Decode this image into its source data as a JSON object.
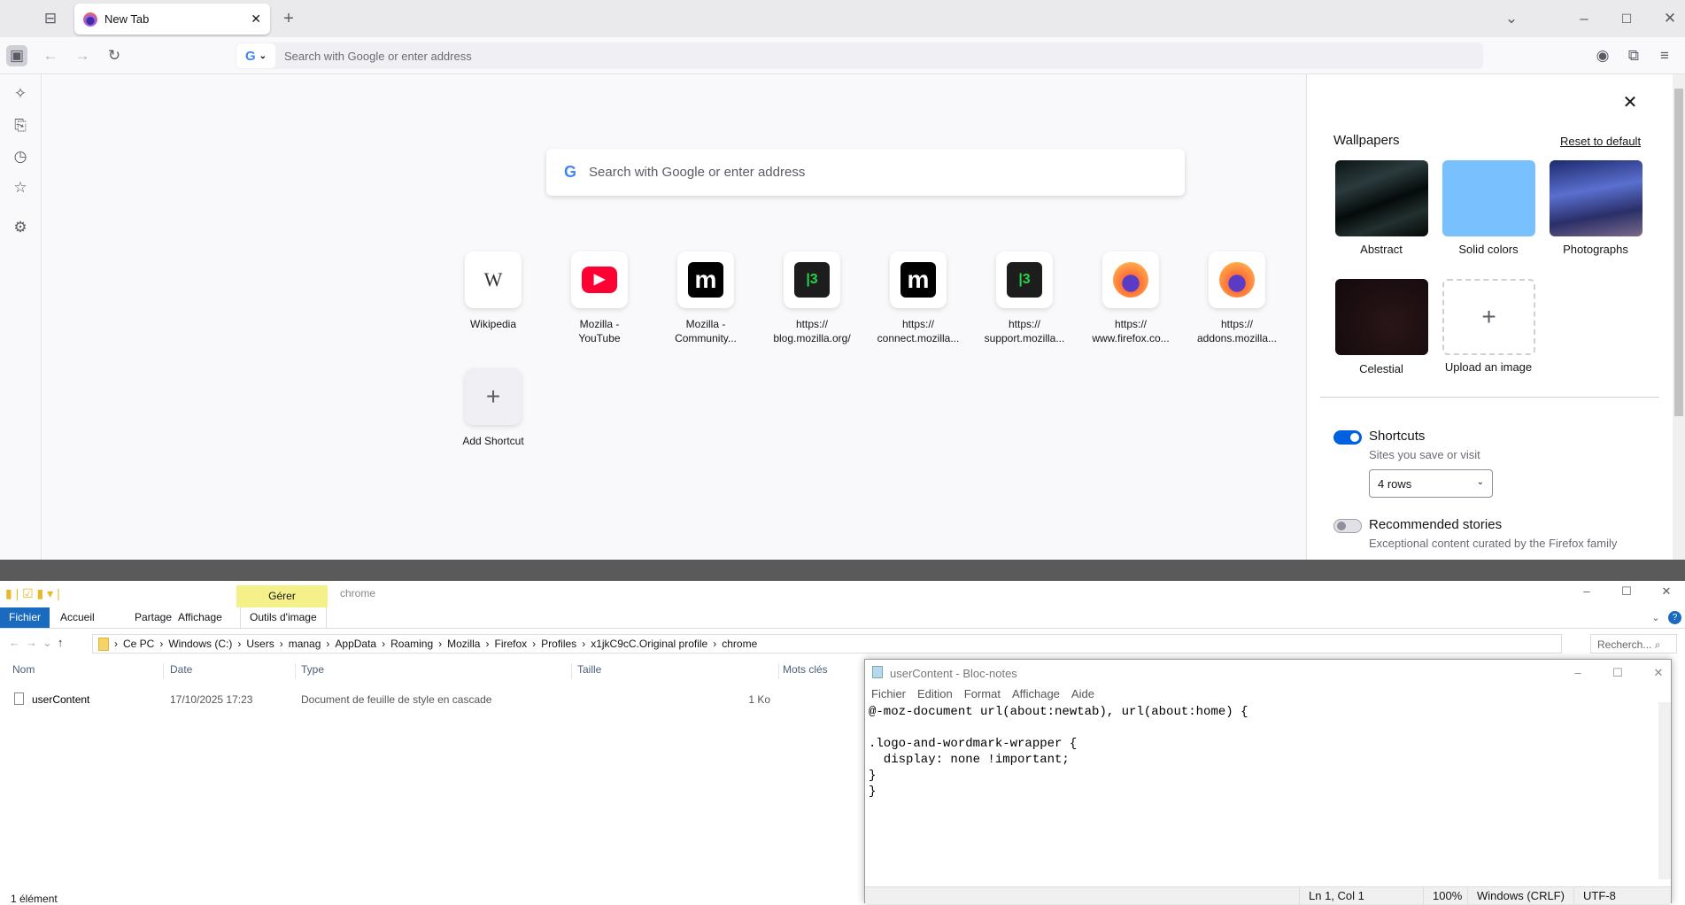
{
  "browser": {
    "tab_title": "New Tab",
    "url_placeholder": "Search with Google or enter address"
  },
  "newtab": {
    "search_placeholder": "Search with Google or enter address",
    "shortcuts": [
      {
        "line1": "Wikipedia",
        "line2": "",
        "icon": "W",
        "bg": "#ffffff",
        "fg": "#333333"
      },
      {
        "line1": "Mozilla -",
        "line2": "YouTube",
        "icon": "▶",
        "bg": "#ff0033",
        "fg": "#ffffff"
      },
      {
        "line1": "Mozilla -",
        "line2": "Community...",
        "icon": "m",
        "bg": "#000000",
        "fg": "#ffffff"
      },
      {
        "line1": "https://",
        "line2": "blog.mozilla.org/",
        "icon": "|3",
        "bg": "#1d1d1d",
        "fg": "#22d34b"
      },
      {
        "line1": "https://",
        "line2": "connect.mozilla...",
        "icon": "m",
        "bg": "#000000",
        "fg": "#ffffff"
      },
      {
        "line1": "https://",
        "line2": "support.mozilla...",
        "icon": "|3",
        "bg": "#1d1d1d",
        "fg": "#22d34b"
      },
      {
        "line1": "https://",
        "line2": "www.firefox.co...",
        "icon": "ff",
        "bg": "#ffffff",
        "fg": "#ff7139"
      },
      {
        "line1": "https://",
        "line2": "addons.mozilla...",
        "icon": "ff",
        "bg": "#ffffff",
        "fg": "#ff7139"
      }
    ],
    "add_shortcut": "Add Shortcut"
  },
  "panel": {
    "wallpapers_title": "Wallpapers",
    "reset": "Reset to default",
    "wallpapers": [
      "Abstract",
      "Solid colors",
      "Photographs",
      "Celestial",
      "Upload an image"
    ],
    "shortcuts_label": "Shortcuts",
    "shortcuts_desc": "Sites you save or visit",
    "shortcuts_on": true,
    "rows": "4 rows",
    "stories_label": "Recommended stories",
    "stories_desc": "Exceptional content curated by the Firefox family",
    "stories_on": false
  },
  "explorer": {
    "manage": "Gérer",
    "folder_title": "chrome",
    "ribbon_tabs": [
      "Fichier",
      "Accueil",
      "Partage",
      "Affichage",
      "Outils d'image"
    ],
    "path": [
      "Ce PC",
      "Windows (C:)",
      "Users",
      "manag",
      "AppData",
      "Roaming",
      "Mozilla",
      "Firefox",
      "Profiles",
      "x1jkC9cC.Original profile",
      "chrome"
    ],
    "search_placeholder": "Recherch...",
    "columns": [
      "Nom",
      "Date",
      "Type",
      "Taille",
      "Mots clés"
    ],
    "files": [
      {
        "name": "userContent",
        "date": "17/10/2025 17:23",
        "type": "Document de feuille de style en cascade",
        "size": "1 Ko"
      }
    ],
    "status": "1 élément"
  },
  "notepad": {
    "title": "userContent - Bloc-notes",
    "menu": [
      "Fichier",
      "Edition",
      "Format",
      "Affichage",
      "Aide"
    ],
    "content": "@-moz-document url(about:newtab), url(about:home) {\n\n.logo-and-wordmark-wrapper {\n  display: none !important;\n}\n}",
    "status": {
      "position": "Ln 1, Col 1",
      "zoom": "100%",
      "eol": "Windows (CRLF)",
      "encoding": "UTF-8"
    }
  }
}
